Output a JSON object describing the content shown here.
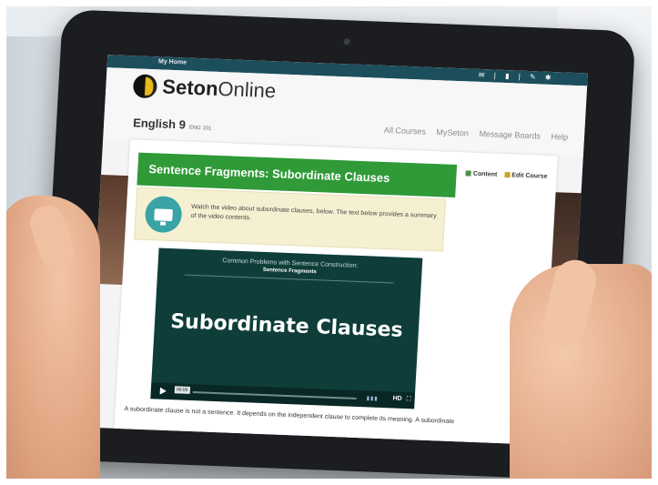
{
  "site": {
    "breadcrumb": "My Home",
    "logo": {
      "bold": "Seton",
      "light": "Online"
    },
    "course_title": "English 9",
    "course_code": "ENG 101",
    "nav": [
      "All Courses",
      "MySeton",
      "Message Boards",
      "Help"
    ]
  },
  "lesson": {
    "title": "Sentence Fragments: Subordinate Clauses",
    "links": [
      "Content",
      "Edit Course"
    ],
    "instructions": "Watch the video about subordinate clauses, below. The text below provides a summary of the video contents.",
    "paragraph": "A subordinate clause is not a sentence. It depends on the independent clause to complete its meaning. A subordinate"
  },
  "video": {
    "heading": "Common Problems with Sentence Construction:",
    "subheading": "Sentence Fragments",
    "title": "Subordinate Clauses",
    "time": "00:00",
    "quality": "HD"
  },
  "colors": {
    "banner": "#2f9a37",
    "topbar": "#1d4e5c",
    "video_bg": "#0f3e3a",
    "info_bg": "#f6f0d2"
  }
}
